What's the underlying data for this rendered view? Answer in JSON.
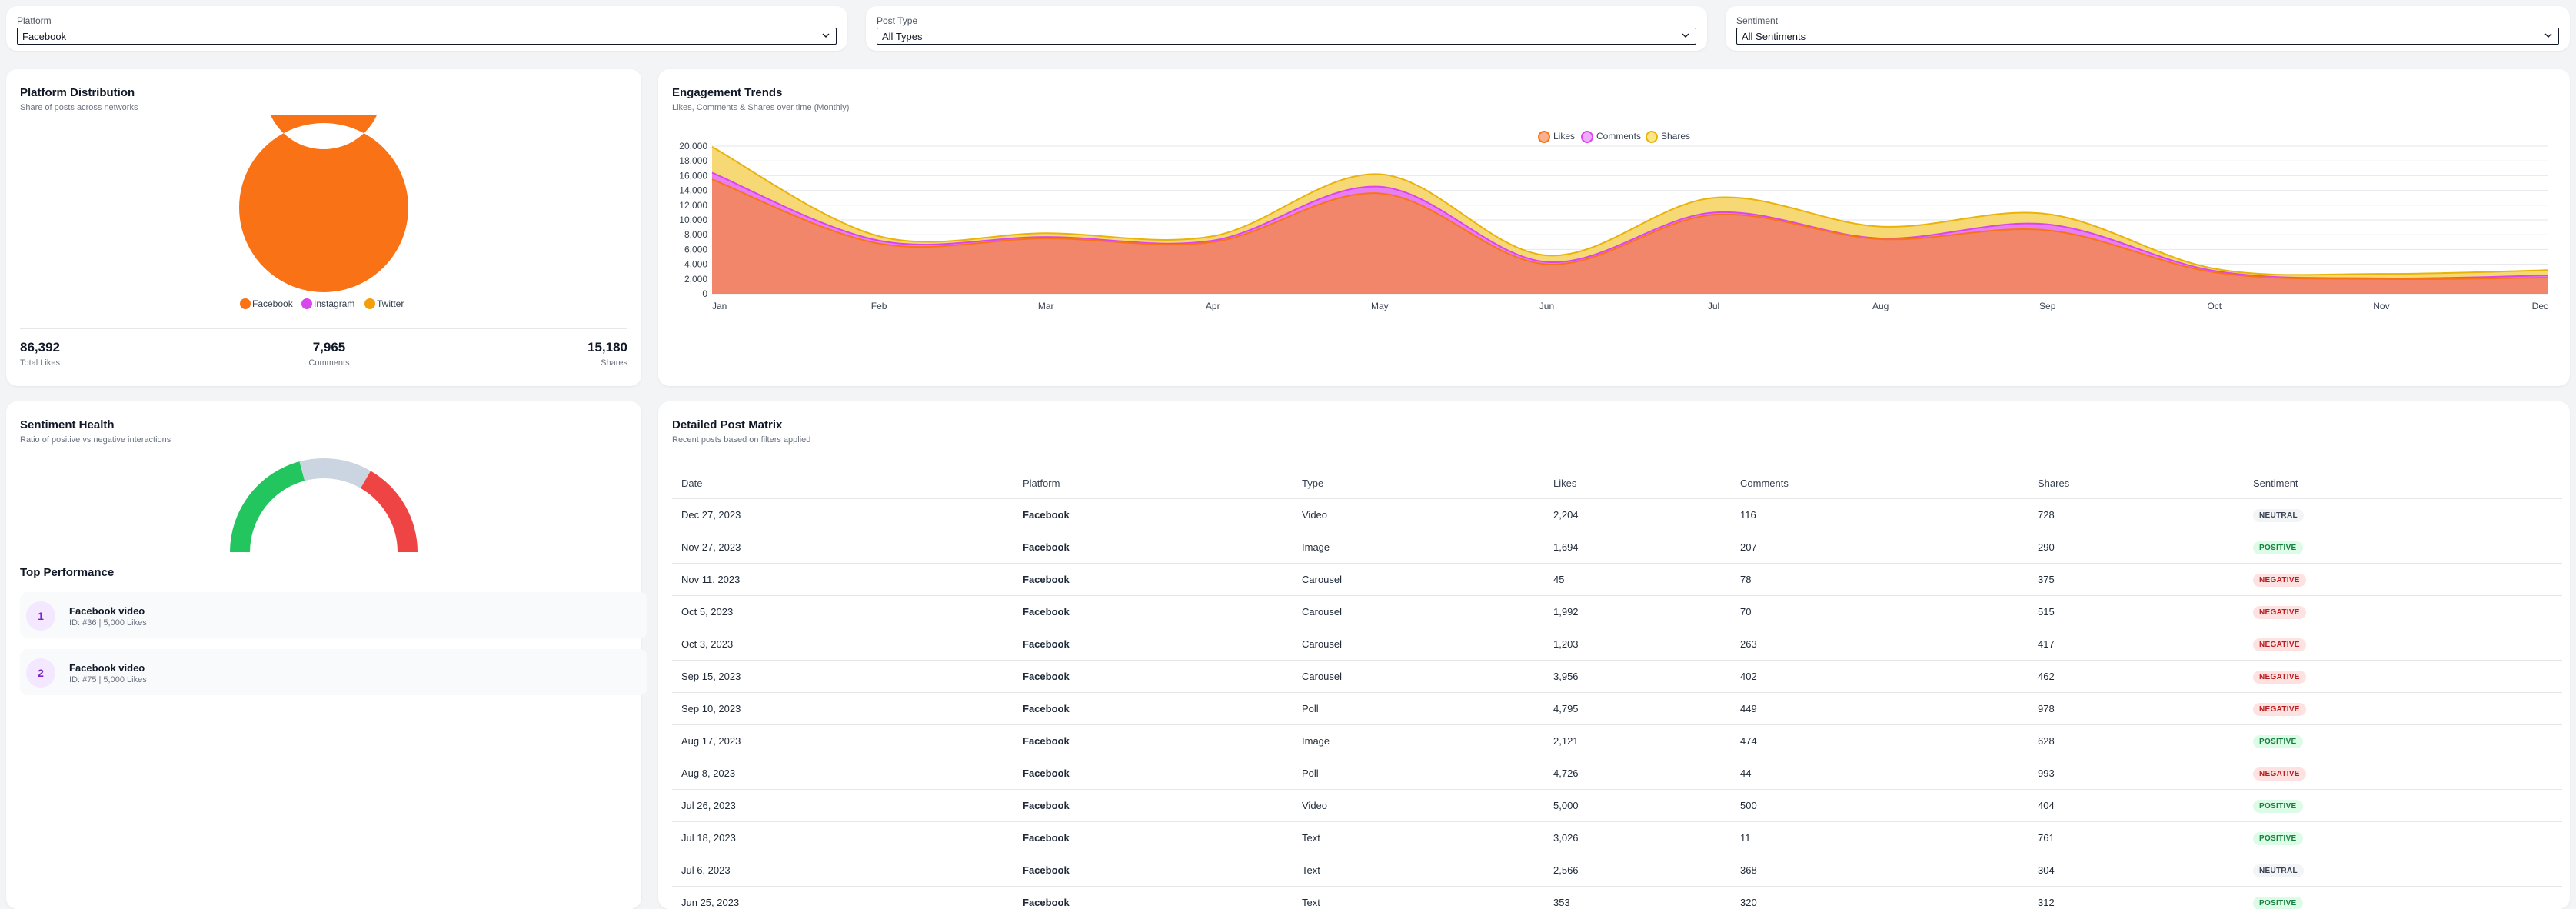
{
  "filters": [
    {
      "label": "Platform",
      "value": "Facebook"
    },
    {
      "label": "Post Type",
      "value": "All Types"
    },
    {
      "label": "Sentiment",
      "value": "All Sentiments"
    }
  ],
  "platform_distribution": {
    "title": "Platform Distribution",
    "subtitle": "Share of posts across networks",
    "legend": [
      "Facebook",
      "Instagram",
      "Twitter"
    ],
    "colors": {
      "Facebook": "#f97316",
      "Instagram": "#d946ef",
      "Twitter": "#f59e0b"
    },
    "stats": [
      {
        "value": "86,392",
        "label": "Total Likes"
      },
      {
        "value": "7,965",
        "label": "Comments"
      },
      {
        "value": "15,180",
        "label": "Shares"
      }
    ]
  },
  "engagement": {
    "title": "Engagement Trends",
    "subtitle": "Likes, Comments & Shares over time (Monthly)",
    "legend": [
      "Likes",
      "Comments",
      "Shares"
    ]
  },
  "chart_data": [
    {
      "type": "pie",
      "categories": [
        "Facebook",
        "Instagram",
        "Twitter"
      ],
      "values": [
        100,
        0,
        0
      ],
      "donut": true,
      "legend": "bottom",
      "colors": [
        "#f97316",
        "#d946ef",
        "#f59e0b"
      ]
    },
    {
      "type": "area",
      "stacked": true,
      "x": [
        "Jan",
        "Feb",
        "Mar",
        "Apr",
        "May",
        "Jun",
        "Jul",
        "Aug",
        "Sep",
        "Oct",
        "Nov",
        "Dec"
      ],
      "yticks": [
        "0",
        "2,000",
        "4,000",
        "6,000",
        "8,000",
        "10,000",
        "12,000",
        "14,000",
        "16,000",
        "18,000",
        "20,000"
      ],
      "ylim": [
        0,
        20000
      ],
      "grid": true,
      "legend": "top-center",
      "series": [
        {
          "name": "Likes",
          "color": "#f2866b",
          "values": [
            15500,
            6800,
            7500,
            7000,
            13600,
            4000,
            10700,
            7400,
            8600,
            2900,
            2000,
            2200
          ]
        },
        {
          "name": "Comments",
          "color": "#e879f9",
          "values": [
            900,
            400,
            200,
            200,
            900,
            300,
            300,
            100,
            800,
            200,
            100,
            300
          ]
        },
        {
          "name": "Shares",
          "color": "#f5d66e",
          "values": [
            3500,
            600,
            500,
            600,
            1700,
            900,
            2000,
            1600,
            1400,
            300,
            600,
            700
          ]
        }
      ]
    },
    {
      "type": "pie",
      "semicircle": true,
      "categories": [
        "Positive",
        "Neutral",
        "Negative"
      ],
      "values": [
        5,
        3,
        4
      ],
      "colors": [
        "#22c55e",
        "#cbd5e1",
        "#ef4444"
      ]
    }
  ],
  "sentiment": {
    "title": "Sentiment Health",
    "subtitle": "Ratio of positive vs negative interactions"
  },
  "top_performance": {
    "title": "Top Performance",
    "items": [
      {
        "rank": "1",
        "title": "Facebook video",
        "sub": "ID: #36 | 5,000 Likes"
      },
      {
        "rank": "2",
        "title": "Facebook video",
        "sub": "ID: #75 | 5,000 Likes"
      }
    ]
  },
  "matrix": {
    "title": "Detailed Post Matrix",
    "subtitle": "Recent posts based on filters applied",
    "columns": [
      "Date",
      "Platform",
      "Type",
      "Likes",
      "Comments",
      "Shares",
      "Sentiment"
    ],
    "rows": [
      {
        "date": "Dec 27, 2023",
        "platform": "Facebook",
        "type": "Video",
        "likes": "2,204",
        "comments": "116",
        "shares": "728",
        "sentiment": "NEUTRAL"
      },
      {
        "date": "Nov 27, 2023",
        "platform": "Facebook",
        "type": "Image",
        "likes": "1,694",
        "comments": "207",
        "shares": "290",
        "sentiment": "POSITIVE"
      },
      {
        "date": "Nov 11, 2023",
        "platform": "Facebook",
        "type": "Carousel",
        "likes": "45",
        "comments": "78",
        "shares": "375",
        "sentiment": "NEGATIVE"
      },
      {
        "date": "Oct 5, 2023",
        "platform": "Facebook",
        "type": "Carousel",
        "likes": "1,992",
        "comments": "70",
        "shares": "515",
        "sentiment": "NEGATIVE"
      },
      {
        "date": "Oct 3, 2023",
        "platform": "Facebook",
        "type": "Carousel",
        "likes": "1,203",
        "comments": "263",
        "shares": "417",
        "sentiment": "NEGATIVE"
      },
      {
        "date": "Sep 15, 2023",
        "platform": "Facebook",
        "type": "Carousel",
        "likes": "3,956",
        "comments": "402",
        "shares": "462",
        "sentiment": "NEGATIVE"
      },
      {
        "date": "Sep 10, 2023",
        "platform": "Facebook",
        "type": "Poll",
        "likes": "4,795",
        "comments": "449",
        "shares": "978",
        "sentiment": "NEGATIVE"
      },
      {
        "date": "Aug 17, 2023",
        "platform": "Facebook",
        "type": "Image",
        "likes": "2,121",
        "comments": "474",
        "shares": "628",
        "sentiment": "POSITIVE"
      },
      {
        "date": "Aug 8, 2023",
        "platform": "Facebook",
        "type": "Poll",
        "likes": "4,726",
        "comments": "44",
        "shares": "993",
        "sentiment": "NEGATIVE"
      },
      {
        "date": "Jul 26, 2023",
        "platform": "Facebook",
        "type": "Video",
        "likes": "5,000",
        "comments": "500",
        "shares": "404",
        "sentiment": "POSITIVE"
      },
      {
        "date": "Jul 18, 2023",
        "platform": "Facebook",
        "type": "Text",
        "likes": "3,026",
        "comments": "11",
        "shares": "761",
        "sentiment": "POSITIVE"
      },
      {
        "date": "Jul 6, 2023",
        "platform": "Facebook",
        "type": "Text",
        "likes": "2,566",
        "comments": "368",
        "shares": "304",
        "sentiment": "NEUTRAL"
      },
      {
        "date": "Jun 25, 2023",
        "platform": "Facebook",
        "type": "Text",
        "likes": "353",
        "comments": "320",
        "shares": "312",
        "sentiment": "POSITIVE"
      }
    ]
  }
}
